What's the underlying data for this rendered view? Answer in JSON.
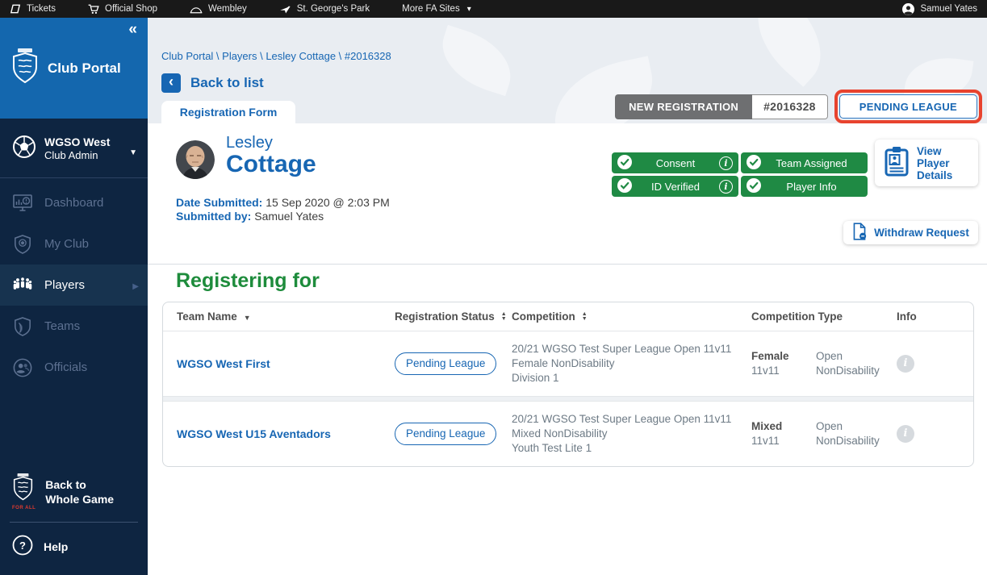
{
  "colors": {
    "brand_blue": "#1766b3",
    "sidebar_header_blue": "#1467ae",
    "sidebar_navy": "#0e2541",
    "status_green": "#1f8a44",
    "badge_gray": "#6e6f71",
    "highlight_red": "#e8432e",
    "page_bg": "#e9edf2"
  },
  "topbar": {
    "items": [
      {
        "label": "Tickets",
        "icon": "ticket-icon"
      },
      {
        "label": "Official Shop",
        "icon": "cart-icon"
      },
      {
        "label": "Wembley",
        "icon": "arch-icon"
      },
      {
        "label": "St. George's Park",
        "icon": "plane-icon"
      },
      {
        "label": "More FA Sites",
        "icon": "chevron-down-icon"
      }
    ],
    "user": {
      "name": "Samuel Yates",
      "icon": "user-icon"
    }
  },
  "sidebar": {
    "brand": "Club Portal",
    "club": {
      "name": "WGSO West",
      "role": "Club Admin"
    },
    "items": [
      {
        "label": "Dashboard",
        "icon": "dashboard-icon"
      },
      {
        "label": "My Club",
        "icon": "shield-ball-icon"
      },
      {
        "label": "Players",
        "icon": "players-group-icon"
      },
      {
        "label": "Teams",
        "icon": "shield-icon"
      },
      {
        "label": "Officials",
        "icon": "officials-icon"
      }
    ],
    "active_item": "Players",
    "footer": {
      "back": "Back to Whole Game",
      "logo_caption": "FOR ALL",
      "help": "Help"
    }
  },
  "breadcrumb": "Club Portal \\ Players \\ Lesley Cottage \\ #2016328",
  "back_to_list": "Back to list",
  "tab_label": "Registration Form",
  "registration_header": {
    "type": "NEW REGISTRATION",
    "id": "#2016328",
    "status": "PENDING LEAGUE"
  },
  "player": {
    "first_name": "Lesley",
    "last_name": "Cottage",
    "date_submitted_label": "Date Submitted:",
    "date_submitted": "15 Sep 2020 @ 2:03 PM",
    "submitted_by_label": "Submitted by:",
    "submitted_by": "Samuel Yates"
  },
  "status_badges": [
    {
      "label": "Consent",
      "info": true
    },
    {
      "label": "Team Assigned",
      "info": false
    },
    {
      "label": "ID Verified",
      "info": true
    },
    {
      "label": "Player Info",
      "info": false
    }
  ],
  "actions": {
    "view_player_details": [
      "View",
      "Player",
      "Details"
    ],
    "withdraw_request": "Withdraw Request"
  },
  "registering_for": {
    "title": "Registering for",
    "columns": {
      "team": "Team Name",
      "status": "Registration Status",
      "competition": "Competition",
      "type": "Competition Type",
      "info": "Info"
    },
    "rows": [
      {
        "team": "WGSO West First",
        "status": "Pending League",
        "competition": "20/21 WGSO Test Super League Open 11v11 Female NonDisability",
        "division": "Division 1",
        "gender": "Female",
        "format": "11v11",
        "category": "Open",
        "disability": "NonDisability"
      },
      {
        "team": "WGSO West U15 Aventadors",
        "status": "Pending League",
        "competition": "20/21 WGSO Test Super League Open 11v11 Mixed NonDisability",
        "division": "Youth Test Lite 1",
        "gender": "Mixed",
        "format": "11v11",
        "category": "Open",
        "disability": "NonDisability"
      }
    ]
  }
}
